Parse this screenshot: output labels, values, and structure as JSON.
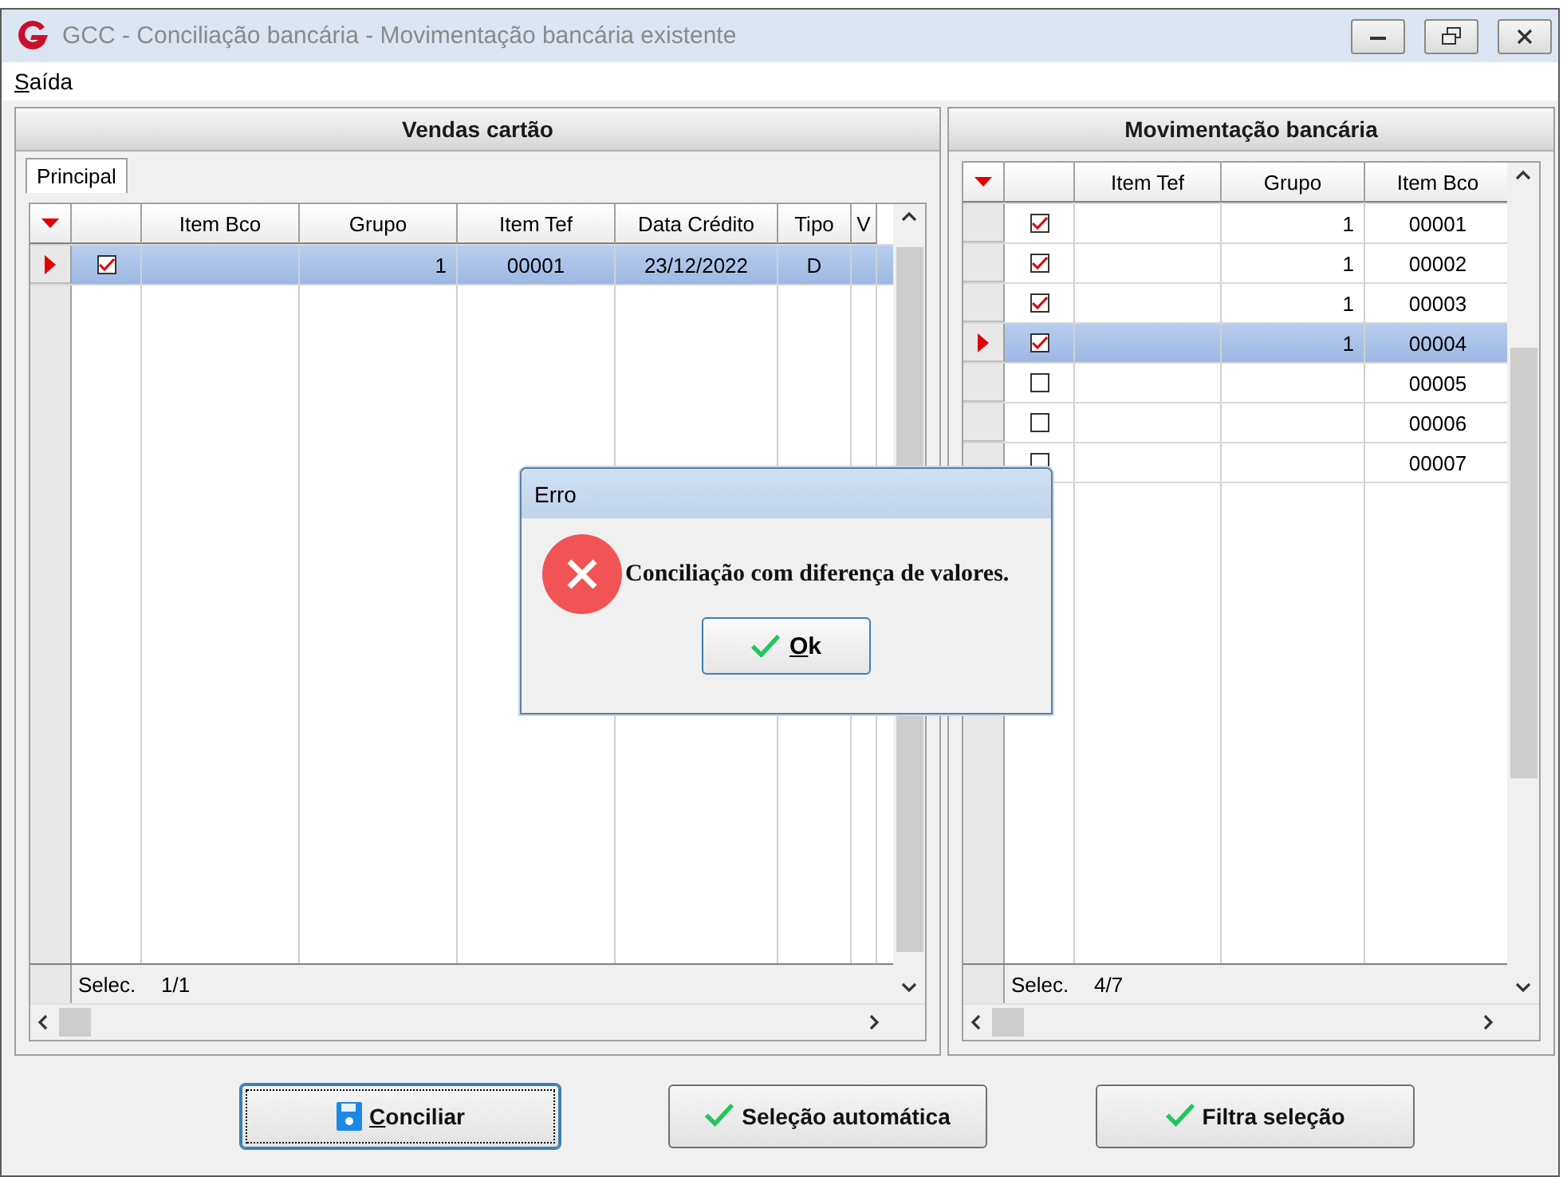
{
  "window": {
    "title": "GCC - Conciliação bancária - Movimentação bancária existente"
  },
  "menu": [
    {
      "label": "Saída"
    }
  ],
  "left_panel": {
    "title": "Vendas cartão",
    "tabs": [
      {
        "label": "Principal",
        "selected": true
      }
    ],
    "grid": {
      "columns": [
        "Item Bco",
        "Grupo",
        "Item Tef",
        "Data Crédito",
        "Tipo",
        "V"
      ],
      "rows": [
        {
          "selected": true,
          "checked": true,
          "cells": [
            "",
            "1",
            "00001",
            "23/12/2022",
            "D",
            ""
          ]
        }
      ],
      "footer": {
        "label": "Selec.",
        "count": "1/1"
      }
    }
  },
  "right_panel": {
    "title": "Movimentação bancária",
    "grid": {
      "columns": [
        "Item Tef",
        "Grupo",
        "Item Bco"
      ],
      "rows": [
        {
          "selected": false,
          "checked": true,
          "cells": [
            "",
            "1",
            "00001"
          ]
        },
        {
          "selected": false,
          "checked": true,
          "cells": [
            "",
            "1",
            "00002"
          ]
        },
        {
          "selected": false,
          "checked": true,
          "cells": [
            "",
            "1",
            "00003"
          ]
        },
        {
          "selected": true,
          "checked": true,
          "cells": [
            "",
            "1",
            "00004"
          ]
        },
        {
          "selected": false,
          "checked": false,
          "cells": [
            "",
            "",
            "00005"
          ]
        },
        {
          "selected": false,
          "checked": false,
          "cells": [
            "",
            "",
            "00006"
          ]
        },
        {
          "selected": false,
          "checked": false,
          "cells": [
            "",
            "",
            "00007"
          ]
        }
      ],
      "footer": {
        "label": "Selec.",
        "count": "4/7"
      }
    }
  },
  "buttons": [
    {
      "label": "Conciliar",
      "kind": "save",
      "focused": true
    },
    {
      "label": "Seleção automática",
      "kind": "check",
      "focused": false
    },
    {
      "label": "Filtra seleção",
      "kind": "check",
      "focused": false
    }
  ],
  "dialog": {
    "title": "Erro",
    "message": "Conciliação com diferença de valores.",
    "button": "Ok"
  }
}
